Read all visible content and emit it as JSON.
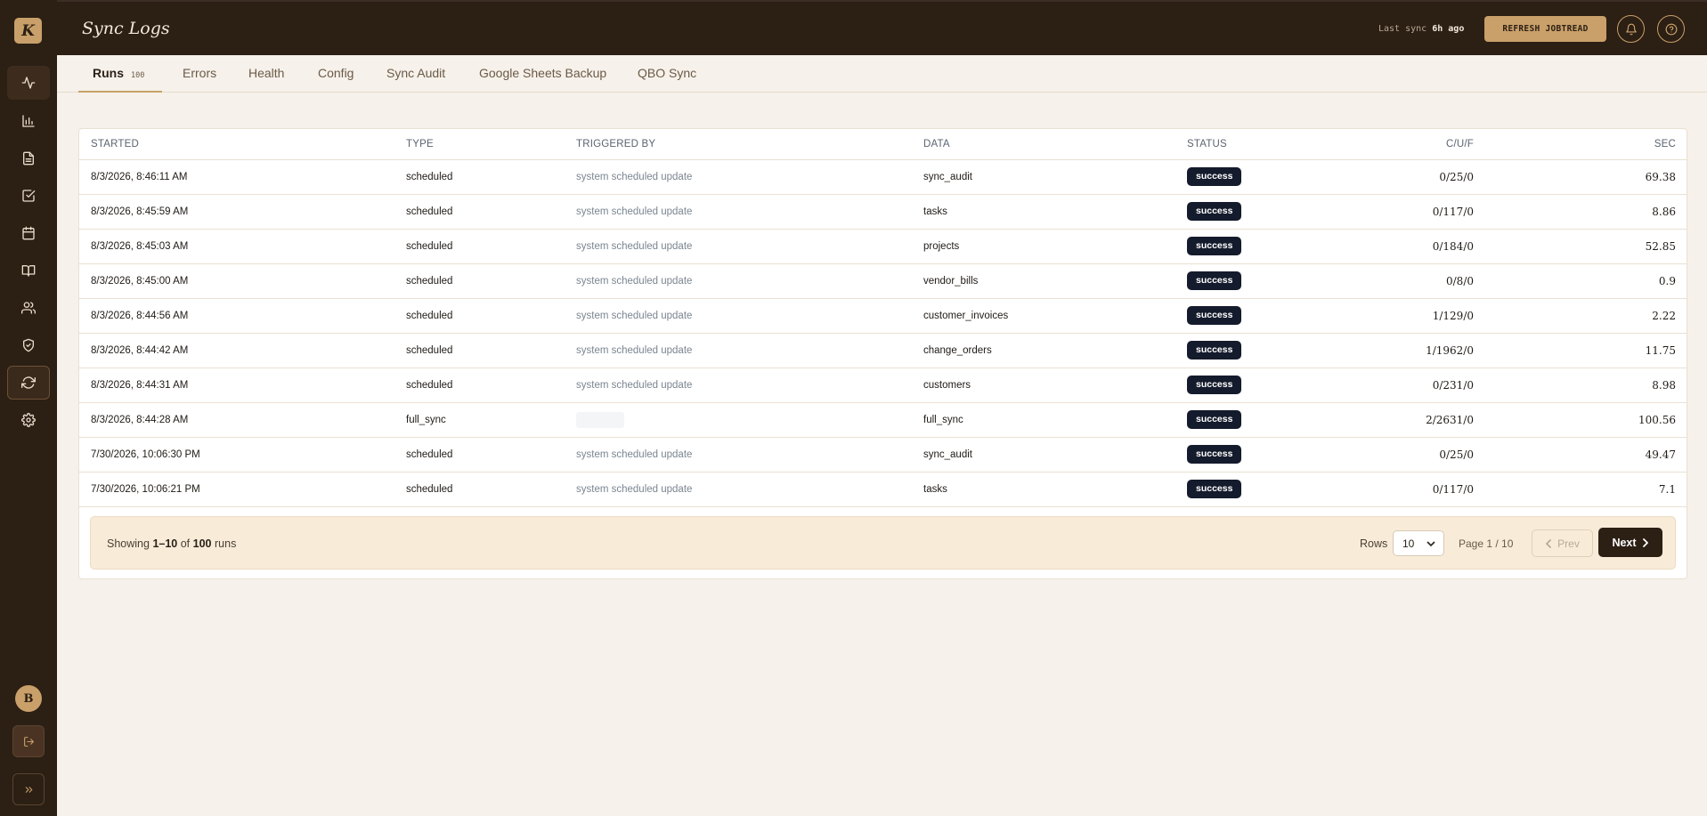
{
  "app": {
    "logo_letter": "K",
    "page_title": "Sync Logs",
    "last_sync_label": "Last sync",
    "last_sync_value": "6h ago",
    "refresh_label": "REFRESH JOBTREAD",
    "avatar_initial": "B",
    "accent_color": "#c9a06a",
    "dark_color": "#2c1f14"
  },
  "sidebar": {
    "items": [
      {
        "icon": "activity-icon"
      },
      {
        "icon": "bar-chart-icon"
      },
      {
        "icon": "document-icon"
      },
      {
        "icon": "checkbox-icon"
      },
      {
        "icon": "calendar-icon"
      },
      {
        "icon": "book-icon"
      },
      {
        "icon": "users-icon"
      },
      {
        "icon": "shield-check-icon"
      },
      {
        "icon": "refresh-icon",
        "current": true
      },
      {
        "icon": "gear-icon"
      }
    ]
  },
  "tabs": [
    {
      "label": "Runs",
      "count": "100",
      "active": true
    },
    {
      "label": "Errors"
    },
    {
      "label": "Health"
    },
    {
      "label": "Config"
    },
    {
      "label": "Sync Audit"
    },
    {
      "label": "Google Sheets Backup"
    },
    {
      "label": "QBO Sync"
    }
  ],
  "table": {
    "columns": [
      "STARTED",
      "TYPE",
      "TRIGGERED BY",
      "DATA",
      "STATUS",
      "C/U/F",
      "SEC"
    ],
    "rows": [
      {
        "started": "8/3/2026, 8:46:11 AM",
        "type": "scheduled",
        "triggered_by": "system scheduled update",
        "data": "sync_audit",
        "status": "success",
        "cuf": "0/25/0",
        "sec": "69.38"
      },
      {
        "started": "8/3/2026, 8:45:59 AM",
        "type": "scheduled",
        "triggered_by": "system scheduled update",
        "data": "tasks",
        "status": "success",
        "cuf": "0/117/0",
        "sec": "8.86"
      },
      {
        "started": "8/3/2026, 8:45:03 AM",
        "type": "scheduled",
        "triggered_by": "system scheduled update",
        "data": "projects",
        "status": "success",
        "cuf": "0/184/0",
        "sec": "52.85"
      },
      {
        "started": "8/3/2026, 8:45:00 AM",
        "type": "scheduled",
        "triggered_by": "system scheduled update",
        "data": "vendor_bills",
        "status": "success",
        "cuf": "0/8/0",
        "sec": "0.9"
      },
      {
        "started": "8/3/2026, 8:44:56 AM",
        "type": "scheduled",
        "triggered_by": "system scheduled update",
        "data": "customer_invoices",
        "status": "success",
        "cuf": "1/129/0",
        "sec": "2.22"
      },
      {
        "started": "8/3/2026, 8:44:42 AM",
        "type": "scheduled",
        "triggered_by": "system scheduled update",
        "data": "change_orders",
        "status": "success",
        "cuf": "1/1962/0",
        "sec": "11.75"
      },
      {
        "started": "8/3/2026, 8:44:31 AM",
        "type": "scheduled",
        "triggered_by": "system scheduled update",
        "data": "customers",
        "status": "success",
        "cuf": "0/231/0",
        "sec": "8.98"
      },
      {
        "started": "8/3/2026, 8:44:28 AM",
        "type": "full_sync",
        "triggered_by": "",
        "data": "full_sync",
        "status": "success",
        "cuf": "2/2631/0",
        "sec": "100.56"
      },
      {
        "started": "7/30/2026, 10:06:30 PM",
        "type": "scheduled",
        "triggered_by": "system scheduled update",
        "data": "sync_audit",
        "status": "success",
        "cuf": "0/25/0",
        "sec": "49.47"
      },
      {
        "started": "7/30/2026, 10:06:21 PM",
        "type": "scheduled",
        "triggered_by": "system scheduled update",
        "data": "tasks",
        "status": "success",
        "cuf": "0/117/0",
        "sec": "7.1"
      }
    ]
  },
  "pagination": {
    "showing_prefix": "Showing",
    "range": "1–10",
    "of": "of",
    "total": "100",
    "unit": "runs",
    "rows_label": "Rows",
    "rows_value": "10",
    "page_info": "Page 1 / 10",
    "prev_label": "Prev",
    "next_label": "Next"
  }
}
